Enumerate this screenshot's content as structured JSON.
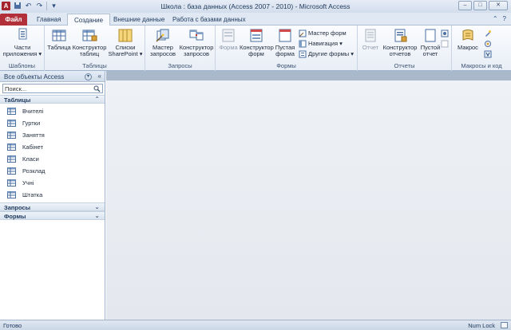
{
  "window": {
    "app_icon": "A",
    "title": "Школа : база данных (Access 2007 - 2010)  -  Microsoft Access",
    "controls": [
      "–",
      "□",
      "✕"
    ]
  },
  "ribbon_tabs": {
    "file": "Файл",
    "tabs": [
      "Главная",
      "Создание",
      "Внешние данные",
      "Работа с базами данных"
    ],
    "active_index": 1
  },
  "ribbon": {
    "groups": {
      "templates": {
        "label": "Шаблоны",
        "buttons": [
          {
            "label": "Части приложения ▾"
          }
        ]
      },
      "tables": {
        "label": "Таблицы",
        "buttons": [
          {
            "label": "Таблица"
          },
          {
            "label": "Конструктор таблиц"
          },
          {
            "label": "Списки SharePoint ▾"
          }
        ]
      },
      "queries": {
        "label": "Запросы",
        "buttons": [
          {
            "label": "Мастер запросов"
          },
          {
            "label": "Конструктор запросов"
          }
        ]
      },
      "forms": {
        "label": "Формы",
        "buttons": [
          {
            "label": "Форма"
          },
          {
            "label": "Конструктор форм"
          },
          {
            "label": "Пустая форма"
          }
        ],
        "small": [
          "Мастер форм",
          "Навигация ▾",
          "Другие формы ▾"
        ]
      },
      "reports": {
        "label": "Отчеты",
        "buttons": [
          {
            "label": "Отчет"
          },
          {
            "label": "Конструктор отчетов"
          },
          {
            "label": "Пустой отчет"
          }
        ]
      },
      "macros": {
        "label": "Макросы и код",
        "buttons": [
          {
            "label": "Макрос"
          }
        ]
      }
    }
  },
  "nav": {
    "title": "Все объекты Access",
    "search_placeholder": "Поиск...",
    "categories": [
      {
        "title": "Таблицы",
        "chevron": "⌃",
        "items": [
          "Вчителі",
          "Гуртки",
          "Заняття",
          "Кабінет",
          "Класи",
          "Розклад",
          "Учні",
          "Штатка"
        ]
      },
      {
        "title": "Запросы",
        "chevron": "⌄"
      },
      {
        "title": "Формы",
        "chevron": "⌄"
      }
    ]
  },
  "status": {
    "left": "Готово",
    "right": "Num Lock"
  },
  "colors": {
    "file_tab": "#b1303a",
    "accent": "#1e395b",
    "workspace_bar": "#a9b8cb"
  }
}
